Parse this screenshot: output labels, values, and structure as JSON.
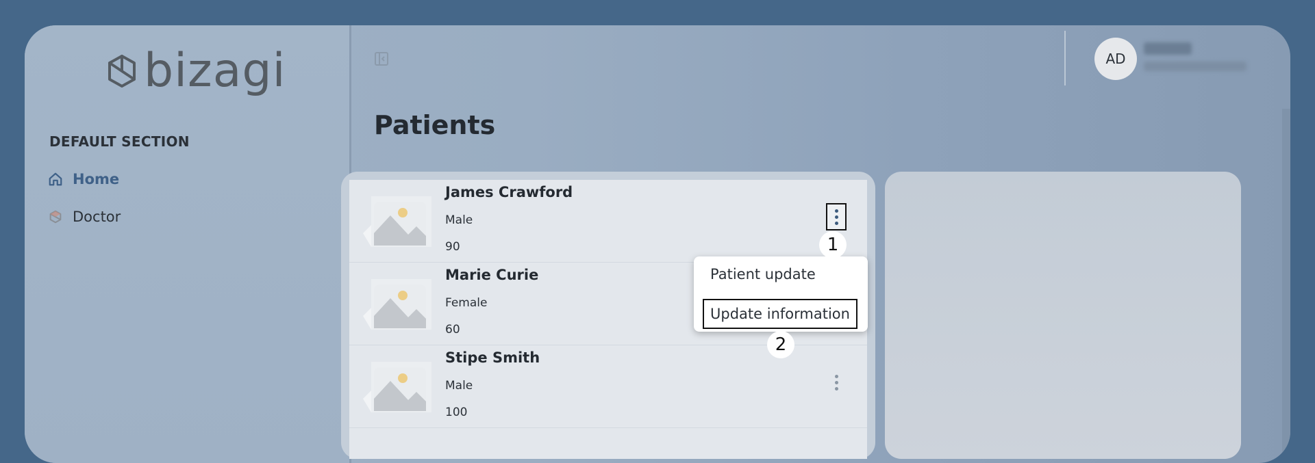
{
  "brand": {
    "logo_text": "bizagi"
  },
  "sidebar": {
    "section_title": "DEFAULT SECTION",
    "items": [
      {
        "label": "Home",
        "icon": "home-icon",
        "active": true
      },
      {
        "label": "Doctor",
        "icon": "doctor-icon",
        "active": false
      }
    ]
  },
  "header": {
    "avatar_initials": "AD"
  },
  "page": {
    "title": "Patients"
  },
  "patients": [
    {
      "name": "James Crawford",
      "gender": "Male",
      "age": "90"
    },
    {
      "name": "Marie Curie",
      "gender": "Female",
      "age": "60"
    },
    {
      "name": "Stipe Smith",
      "gender": "Male",
      "age": "100"
    }
  ],
  "context_menu": {
    "items": [
      "Patient update",
      "Update information"
    ]
  },
  "step_markers": [
    "1",
    "2"
  ],
  "colors": {
    "accent": "#3f6188",
    "background": "#456789"
  }
}
